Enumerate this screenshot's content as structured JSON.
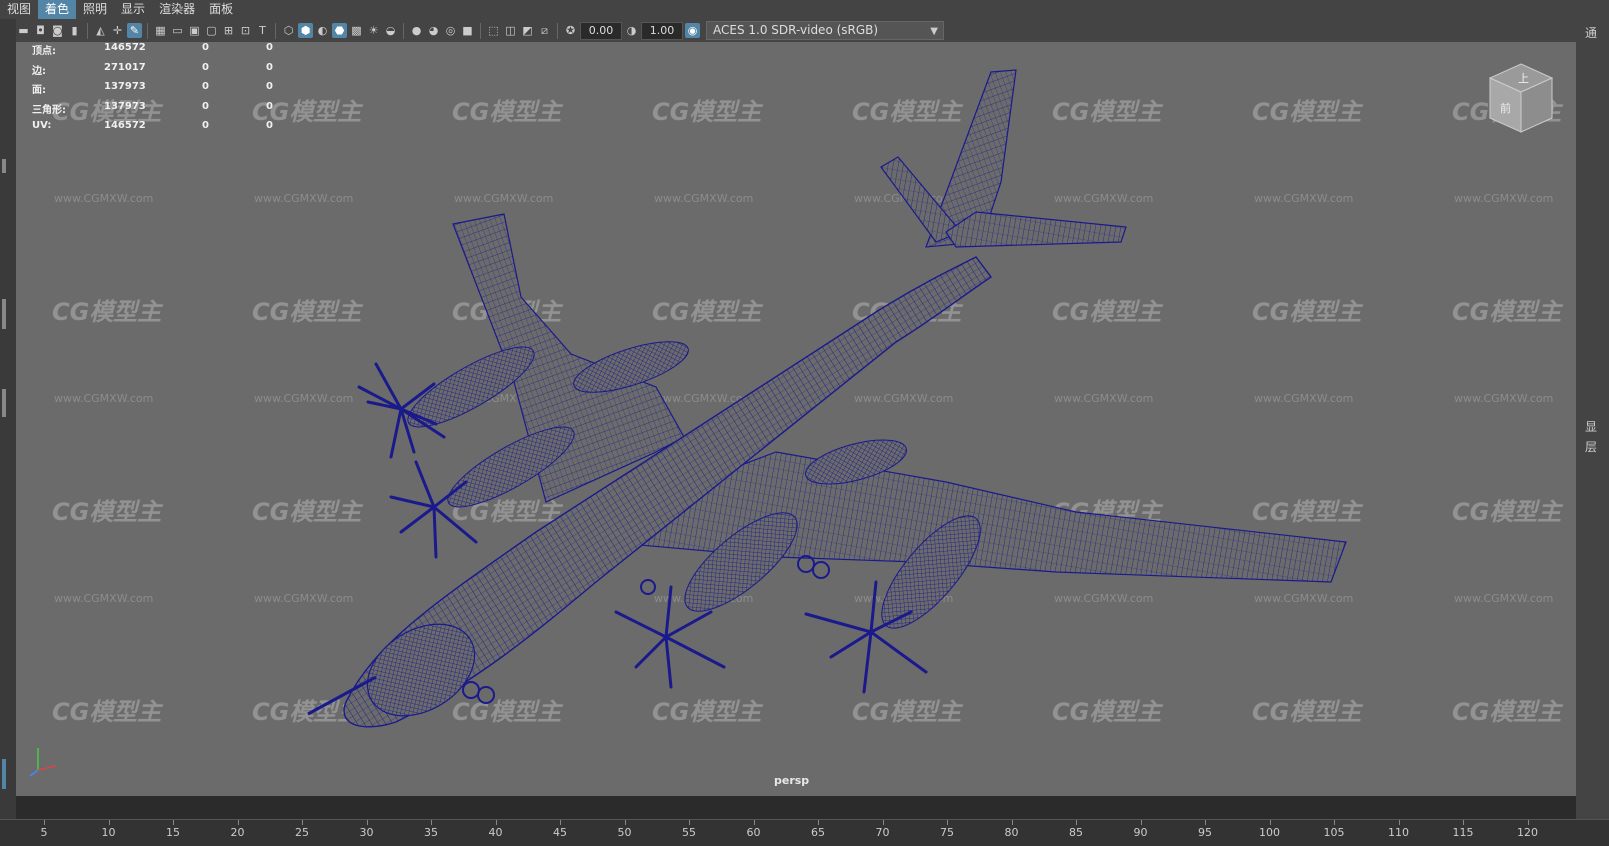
{
  "menubar": {
    "items": [
      "视图",
      "着色",
      "照明",
      "显示",
      "渲染器",
      "面板"
    ],
    "active_index": 1
  },
  "toolbar": {
    "exposure_value": "0.00",
    "gamma_value": "1.00",
    "color_space": "ACES 1.0 SDR-video (sRGB)"
  },
  "hud": {
    "rows": [
      {
        "label": "顶点:",
        "v1": "146572",
        "v2": "0",
        "v3": "0"
      },
      {
        "label": "边:",
        "v1": "271017",
        "v2": "0",
        "v3": "0"
      },
      {
        "label": "面:",
        "v1": "137973",
        "v2": "0",
        "v3": "0"
      },
      {
        "label": "三角形:",
        "v1": "137973",
        "v2": "0",
        "v3": "0"
      },
      {
        "label": "UV:",
        "v1": "146572",
        "v2": "0",
        "v3": "0"
      }
    ]
  },
  "viewport": {
    "camera": "persp",
    "watermark_logo": "CG模型主",
    "watermark_url": "www.CGMXW.com",
    "wireframe_color": "#1a1a8c",
    "background_color": "#6b6b6b"
  },
  "viewcube": {
    "top_label": "上",
    "front_label": "前"
  },
  "right_panel": {
    "labels": [
      "通",
      "显",
      "层"
    ]
  },
  "timeline": {
    "ticks": [
      "5",
      "10",
      "15",
      "20",
      "25",
      "30",
      "35",
      "40",
      "45",
      "50",
      "55",
      "60",
      "65",
      "70",
      "75",
      "80",
      "85",
      "90",
      "95",
      "100",
      "105",
      "110",
      "115",
      "120"
    ]
  }
}
